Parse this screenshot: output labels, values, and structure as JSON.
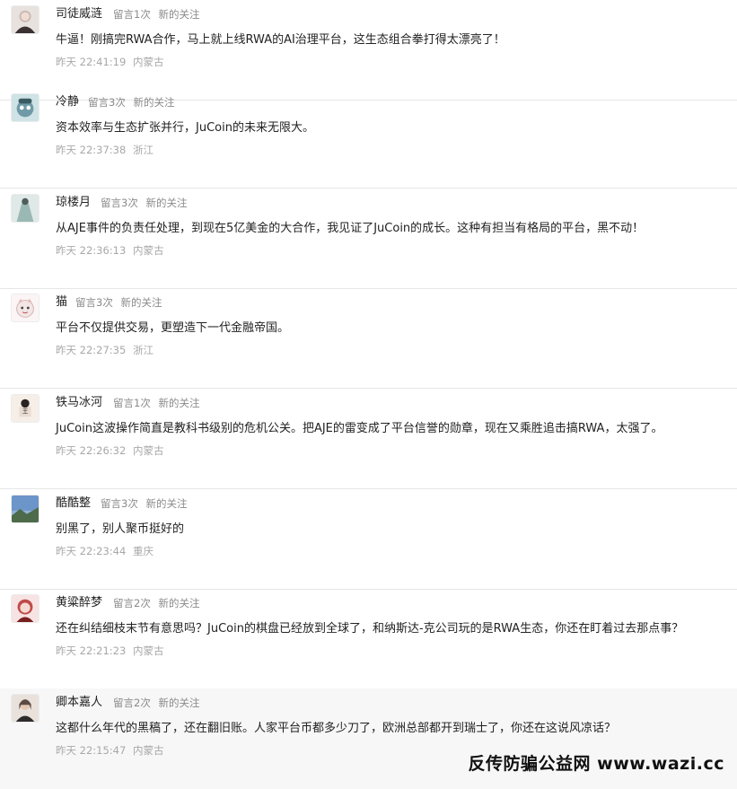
{
  "comments": [
    {
      "name": "司徒威涟",
      "count": "留言1次",
      "tag": "新的关注",
      "text": "牛逼！刚搞完RWA合作，马上就上线RWA的AI治理平台，这生态组合拳打得太漂亮了！",
      "time": "昨天 22:41:19",
      "location": "内蒙古",
      "avatar_icon": "avatar-woman-icon",
      "avatar_color": "#c9b8b3"
    },
    {
      "name": "冷静",
      "count": "留言3次",
      "tag": "新的关注",
      "text": "资本效率与生态扩张并行，JuCoin的未来无限大。",
      "time": "昨天 22:37:38",
      "location": "浙江",
      "avatar_icon": "avatar-cartoon-icon",
      "avatar_color": "#6f9aa6"
    },
    {
      "name": "琼楼月",
      "count": "留言3次",
      "tag": "新的关注",
      "text": "从AJE事件的负责任处理，到现在5亿美金的大合作，我见证了JuCoin的成长。这种有担当有格局的平台，黑不动！",
      "time": "昨天 22:36:13",
      "location": "内蒙古",
      "avatar_icon": "avatar-figure-icon",
      "avatar_color": "#9bb9b4"
    },
    {
      "name": "猫",
      "count": "留言3次",
      "tag": "新的关注",
      "text": "平台不仅提供交易，更塑造下一代金融帝国。",
      "time": "昨天 22:27:35",
      "location": "浙江",
      "avatar_icon": "avatar-cat-icon",
      "avatar_color": "#f2e6e6"
    },
    {
      "name": "铁马冰河",
      "count": "留言1次",
      "tag": "新的关注",
      "text": "JuCoin这波操作简直是教科书级别的危机公关。把AJE的雷变成了平台信誉的勋章，现在又乘胜追击搞RWA，太强了。",
      "time": "昨天 22:26:32",
      "location": "内蒙古",
      "avatar_icon": "avatar-doll-icon",
      "avatar_color": "#e9dcd2"
    },
    {
      "name": "酷酷整",
      "count": "留言3次",
      "tag": "新的关注",
      "text": "别黑了，别人聚币挺好的",
      "time": "昨天 22:23:44",
      "location": "重庆",
      "avatar_icon": "avatar-landscape-icon",
      "avatar_color": "#6c95c9"
    },
    {
      "name": "黄粱醉梦",
      "count": "留言2次",
      "tag": "新的关注",
      "text": "还在纠结细枝末节有意思吗？JuCoin的棋盘已经放到全球了，和纳斯达-克公司玩的是RWA生态，你还在盯着过去那点事？",
      "time": "昨天 22:21:23",
      "location": "内蒙古",
      "avatar_icon": "avatar-anime-icon",
      "avatar_color": "#c04a4a"
    },
    {
      "name": "卿本嘉人",
      "count": "留言2次",
      "tag": "新的关注",
      "text": "这都什么年代的黑稿了，还在翻旧账。人家平台币都多少刀了，欧洲总部都开到瑞士了，你还在这说风凉话？",
      "time": "昨天 22:15:47",
      "location": "内蒙古",
      "avatar_icon": "avatar-portrait-icon",
      "avatar_color": "#5a4a42"
    }
  ],
  "watermark": "反传防骗公益网 www.wazi.cc"
}
